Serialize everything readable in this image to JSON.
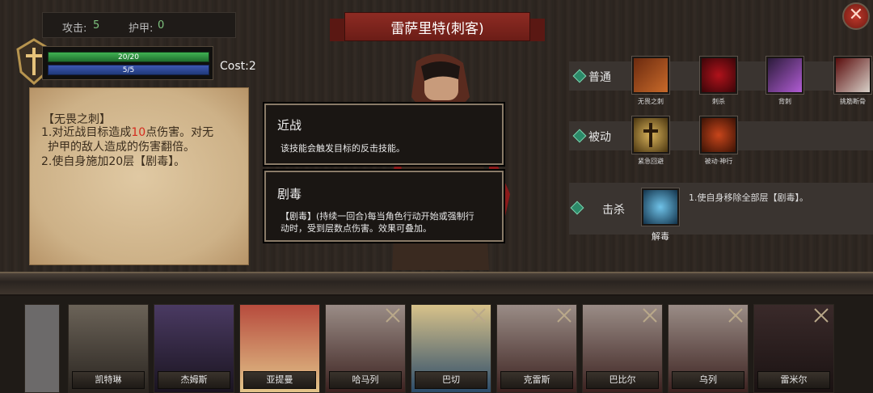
{
  "stats": {
    "attack_label": "攻击:",
    "attack_value": "5",
    "armor_label": "护甲:",
    "armor_value": "0"
  },
  "bars": {
    "hp": "20/20",
    "mp": "5/5"
  },
  "cost": "Cost:2",
  "skill_detail": {
    "title": "【无畏之刺】",
    "line1_a": "1.对近战目标造成",
    "line1_red": "10",
    "line1_b": "点伤害。对无",
    "line2": "护甲的敌人造成的伤害翻倍。",
    "line3": "2.使自身施加20层【剧毒】。"
  },
  "character_title": "雷萨里特(刺客)",
  "cards": [
    {
      "title": "近战",
      "desc": "该技能会触发目标的反击技能。"
    },
    {
      "title": "剧毒",
      "desc_line1": "【剧毒】(持续一回合)每当角色行动开始或强制行",
      "desc_line2": "动时，受到层数点伤害。效果可叠加。"
    }
  ],
  "skills": {
    "normal_label": "普通",
    "normal": [
      "无畏之刺",
      "刺杀",
      "背刺",
      "挑筋断骨"
    ],
    "passive_label": "被动",
    "passive": [
      "紧急回避",
      "被动·神行"
    ],
    "kill_label": "击杀",
    "kill_skill": "解毒",
    "kill_desc": "1.使自身移除全部层【剧毒】。"
  },
  "roster": [
    "凯特琳",
    "杰姆斯",
    "亚提曼",
    "哈马列",
    "巴切",
    "克雷斯",
    "巴比尔",
    "乌列",
    "雷米尔"
  ],
  "colors": {
    "banner": "#8e2b23",
    "hp": "#3fb152",
    "mp": "#3c57b2",
    "accent_red": "#d42b1e"
  }
}
